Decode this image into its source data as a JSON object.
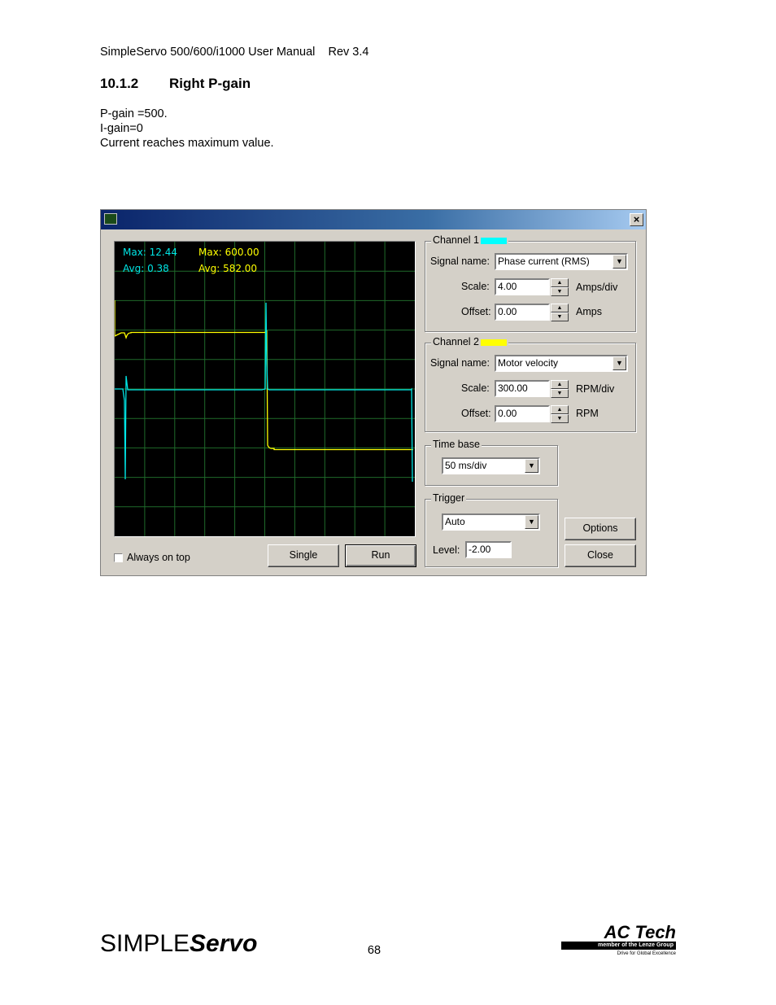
{
  "header": {
    "text": "SimpleServo 500/600/i1000 User Manual    Rev 3.4"
  },
  "section": {
    "number": "10.1.2",
    "title": "Right P-gain"
  },
  "paragraph": {
    "line1": "P-gain =500.",
    "line2": "I-gain=0",
    "line3": "Current reaches maximum value."
  },
  "dialog": {
    "close_glyph": "×",
    "scope": {
      "ch1_max": "Max: 12.44",
      "ch1_avg": "Avg: 0.38",
      "ch2_max": "Max: 600.00",
      "ch2_avg": "Avg: 582.00",
      "colors": {
        "ch1": "#00e5e5",
        "ch2": "#ffff00",
        "grid": "#1f6a2a",
        "bg": "#000000"
      }
    },
    "channel1": {
      "title": "Channel 1",
      "color": "#00ffff",
      "signal_label": "Signal name:",
      "signal_value": "Phase current (RMS)",
      "scale_label": "Scale:",
      "scale_value": "4.00",
      "scale_unit": "Amps/div",
      "offset_label": "Offset:",
      "offset_value": "0.00",
      "offset_unit": "Amps"
    },
    "channel2": {
      "title": "Channel 2",
      "color": "#ffff00",
      "signal_label": "Signal name:",
      "signal_value": "Motor velocity",
      "scale_label": "Scale:",
      "scale_value": "300.00",
      "scale_unit": "RPM/div",
      "offset_label": "Offset:",
      "offset_value": "0.00",
      "offset_unit": "RPM"
    },
    "timebase": {
      "title": "Time base",
      "value": "50 ms/div"
    },
    "trigger": {
      "title": "Trigger",
      "mode": "Auto",
      "level_label": "Level:",
      "level_value": "-2.00"
    },
    "always_on_top": "Always on top",
    "buttons": {
      "single": "Single",
      "run": "Run",
      "options": "Options",
      "close": "Close"
    }
  },
  "footer": {
    "page": "68",
    "logo_left_a": "SIMPLE",
    "logo_left_b": "Servo",
    "logo_right": "AC Tech",
    "logo_right_bar": "member of the Lenze Group",
    "logo_right_tag": "Drive for Global Excellence"
  }
}
